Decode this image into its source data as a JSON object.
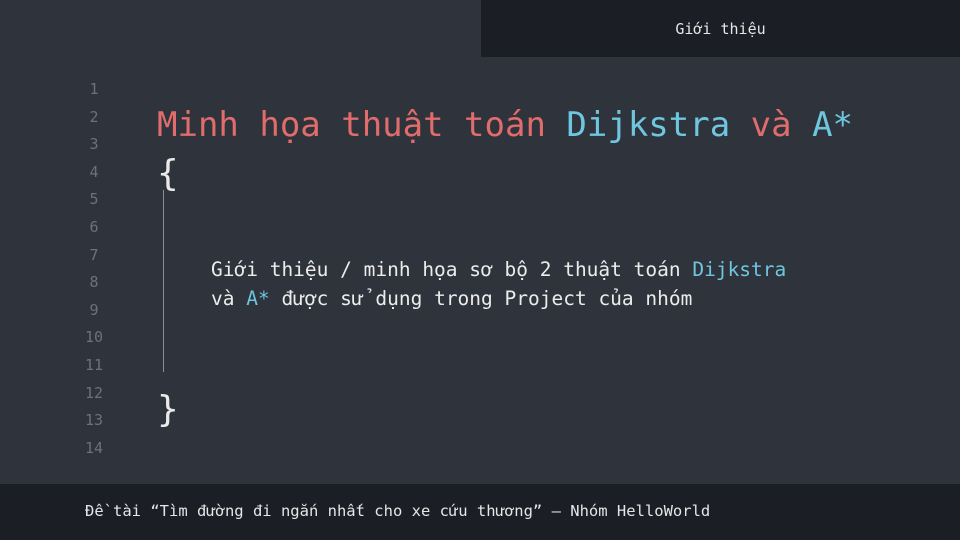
{
  "header": {
    "tab_label": "Giới thiệu"
  },
  "gutter": {
    "line_numbers": [
      "1",
      "2",
      "3",
      "4",
      "5",
      "6",
      "7",
      "8",
      "9",
      "10",
      "11",
      "12",
      "13",
      "14"
    ]
  },
  "title": {
    "part1": "Minh họa thuật toán ",
    "part2": "Dijkstra",
    "part3": " và ",
    "part4": "A*"
  },
  "code": {
    "open_brace": "{",
    "close_brace": "}"
  },
  "description": {
    "line1_text": "Giới thiệu / minh họa sơ bộ 2 thuật toán ",
    "line1_highlight": "Dijkstra",
    "line2_text1": "và ",
    "line2_highlight": "A*",
    "line2_text2": " được sử dụng trong Project của nhóm"
  },
  "footer": {
    "text": "Đề tài “Tìm đường đi ngắn nhất cho xe cứu thương” – Nhóm HelloWorld"
  },
  "colors": {
    "background": "#2f333b",
    "bar": "#1b1e25",
    "keyword_red": "#e06c6c",
    "identifier_cyan": "#6ec6df",
    "line_number_gray": "#6c717b"
  }
}
